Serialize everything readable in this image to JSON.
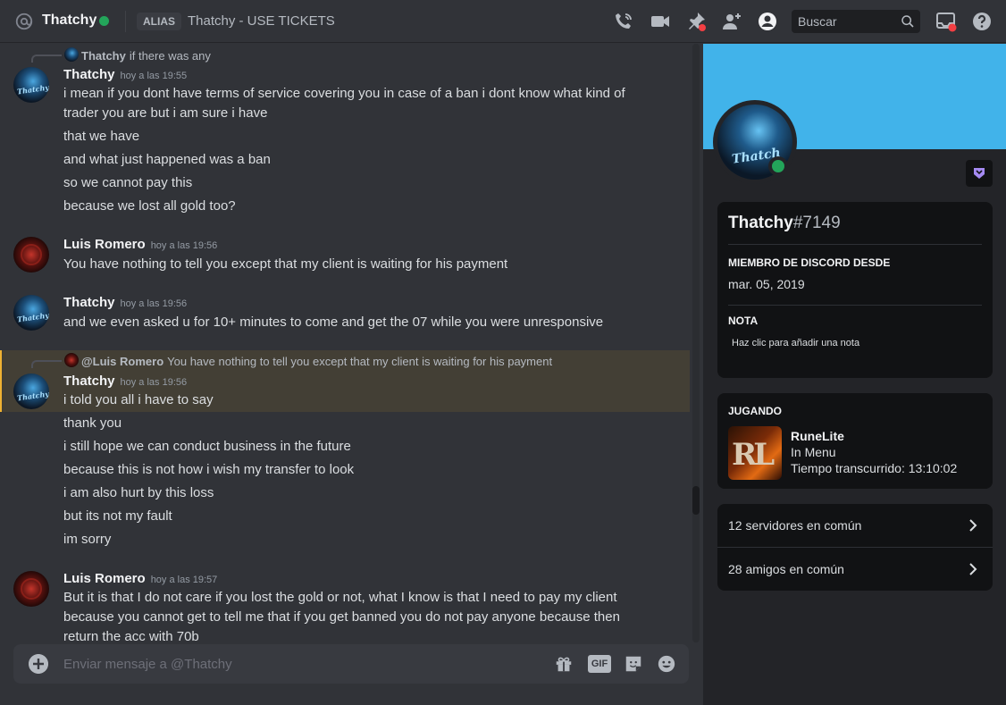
{
  "header": {
    "username": "Thatchy",
    "alias_tag": "ALIAS",
    "alias_text": "Thatchy - USE TICKETS",
    "search_placeholder": "Buscar",
    "icons": [
      "at-icon",
      "phone-call-icon",
      "video-camera-icon",
      "pin-icon",
      "add-friend-icon",
      "profile-icon",
      "search-icon",
      "inbox-icon",
      "help-icon"
    ],
    "online_color": "#23a55a"
  },
  "messages": [
    {
      "reply": {
        "name": "Thatchy",
        "text": "if there was any"
      },
      "author": "Thatchy",
      "time": "hoy a las 19:55",
      "lines": [
        "i mean if you dont have terms of service covering you in case of a ban i dont know what kind of",
        "trader you are but i am sure i have",
        "that we have",
        "and what just happened was a ban",
        "so we cannot pay this",
        "because we lost all gold too?"
      ]
    },
    {
      "author": "Luis Romero",
      "time": "hoy a las 19:56",
      "lines": [
        "You have nothing to tell you except that my client is waiting for his payment"
      ]
    },
    {
      "author": "Thatchy",
      "time": "hoy a las 19:56",
      "lines": [
        "and we even asked u for 10+ minutes to come and get the 07  while you were unresponsive"
      ]
    },
    {
      "reply": {
        "name": "@Luis Romero",
        "text": "You have nothing to tell you except that my client is waiting for his payment"
      },
      "author": "Thatchy",
      "time": "hoy a las 19:56",
      "highlighted": true,
      "lines": [
        "i told you all i have to say",
        "thank you",
        "i still hope we can conduct business in the future",
        "because this is not how i wish my transfer to look",
        "i am also hurt by this loss",
        "but its not my fault",
        "im sorry"
      ]
    },
    {
      "author": "Luis Romero",
      "time": "hoy a las 19:57",
      "lines": [
        "But it is that I do not care if you lost the gold or not, what I know is that I need to pay my client",
        "because you cannot get to tell me that if you get banned you do not pay anyone because then",
        "return the acc with 70b"
      ]
    }
  ],
  "composer": {
    "placeholder": "Enviar mensaje a @Thatchy",
    "gif_label": "GIF"
  },
  "avatars": {
    "thatchy_label": "Thatchy",
    "profile_label": "Thatch"
  },
  "profile": {
    "banner_color": "#41b3ea",
    "name": "Thatchy",
    "discriminator": "#7149",
    "member_since_title": "MIEMBRO DE DISCORD DESDE",
    "member_since": "mar. 05, 2019",
    "note_title": "NOTA",
    "note_placeholder": "Haz clic para añadir una nota",
    "playing_title": "JUGANDO",
    "game": {
      "art_text": "RL",
      "name": "RuneLite",
      "state": "In Menu",
      "elapsed": "Tiempo transcurrido: 13:10:02"
    },
    "mutual_servers": "12 servidores en común",
    "mutual_friends": "28 amigos en común"
  }
}
